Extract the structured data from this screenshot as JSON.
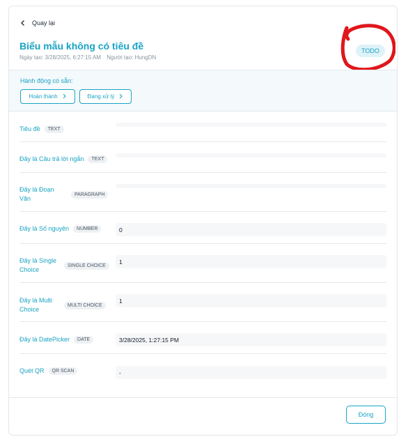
{
  "header": {
    "back_label": "Quay lại",
    "title": "Biểu mẫu không có tiêu đề",
    "created_date": "Ngày tạo: 3/28/2025, 6:27:15 AM",
    "creator": "Người tạo: HungDN",
    "status": "TODO"
  },
  "actions": {
    "label": "Hành động có sẵn:",
    "buttons": [
      {
        "label": "Hoàn thành"
      },
      {
        "label": "Đang xử lý"
      }
    ]
  },
  "fields": [
    {
      "label": "Tiêu đề",
      "type": "TEXT",
      "value": ""
    },
    {
      "label": "Đây là Câu trả lời ngắn",
      "type": "TEXT",
      "value": ""
    },
    {
      "label": "Đây là Đoạn Văn",
      "type": "PARAGRAPH",
      "value": ""
    },
    {
      "label": "Đây là Số nguyên",
      "type": "NUMBER",
      "value": "0"
    },
    {
      "label": "Đây là Single Choice",
      "type": "SINGLE CHOICE",
      "value": "1"
    },
    {
      "label": "Đây là Multi Choice",
      "type": "MULTI CHOICE",
      "value": "1"
    },
    {
      "label": "Đây là DatePicker",
      "type": "DATE",
      "value": "3/28/2025, 1:27:15 PM"
    },
    {
      "label": "Quét QR",
      "type": "QR SCAN",
      "value": "-"
    }
  ],
  "footer": {
    "close_label": "Đóng"
  },
  "colors": {
    "accent": "#19a3c4",
    "annotation": "#e0161b"
  }
}
